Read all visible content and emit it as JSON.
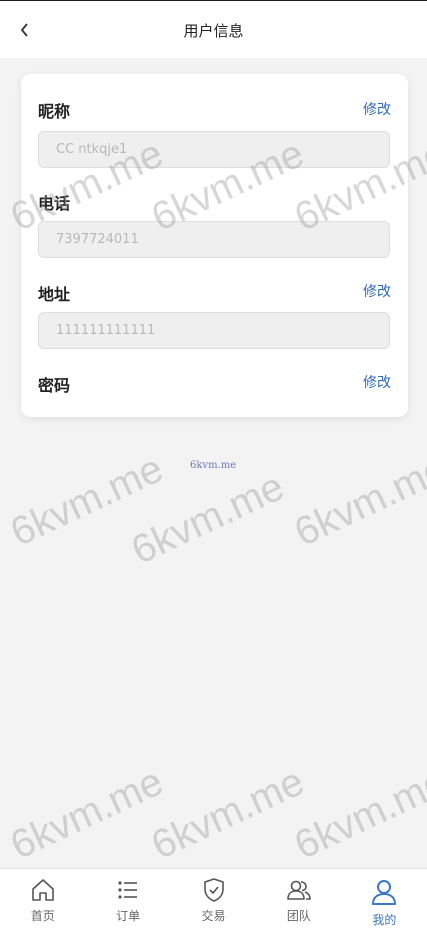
{
  "header": {
    "title": "用户信息"
  },
  "profile": {
    "nickname": {
      "label": "昵称",
      "action": "修改",
      "value": "CC ntkqje1"
    },
    "phone": {
      "label": "电话",
      "value": "7397724011"
    },
    "address": {
      "label": "地址",
      "action": "修改",
      "value": "111111111111"
    },
    "password": {
      "label": "密码",
      "action": "修改"
    }
  },
  "watermark": {
    "text": "6kvm.me",
    "small_text": "6kvm.me"
  },
  "tabbar": {
    "active_color": "#3a78c2",
    "items": [
      {
        "label": "首页",
        "icon": "home-icon"
      },
      {
        "label": "订单",
        "icon": "list-icon"
      },
      {
        "label": "交易",
        "icon": "shield-check-icon"
      },
      {
        "label": "团队",
        "icon": "team-icon"
      },
      {
        "label": "我的",
        "icon": "user-icon",
        "active": true
      }
    ]
  }
}
